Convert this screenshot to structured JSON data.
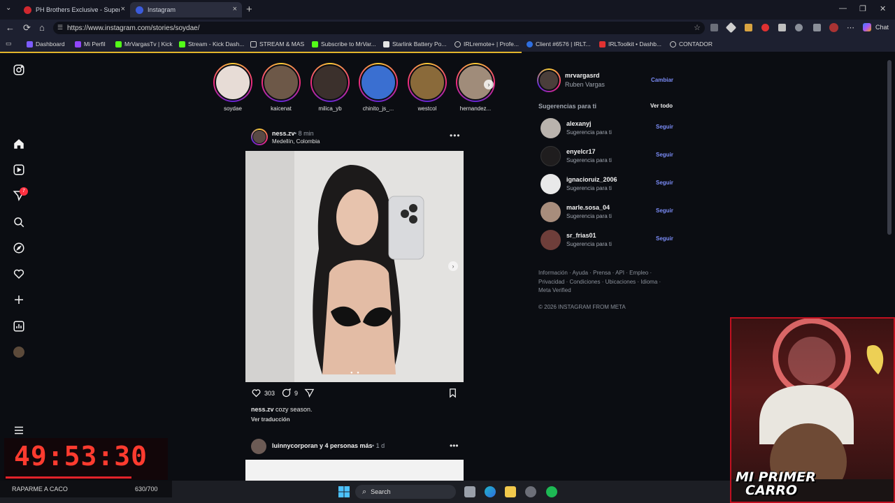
{
  "browser": {
    "tabs": [
      {
        "label": "PH Brothers Exclusive - SuperCarr",
        "active": false
      },
      {
        "label": "Instagram",
        "active": true
      }
    ],
    "url": "https://www.instagram.com/stories/soydae/",
    "chat_label": "Chat",
    "bookmarks": [
      "Dashboard",
      "Mi Perfil",
      "MrVargasTv | Kick",
      "Stream - Kick Dash...",
      "STREAM & MAS",
      "Subscribe to MrVar...",
      "Starlink Battery Po...",
      "IRLremote+ | Profe...",
      "Client #6576 | IRLT...",
      "IRLToolkit • Dashb...",
      "CONTADOR"
    ]
  },
  "sidebar": {
    "icons": [
      "instagram-icon",
      "home-icon",
      "reels-icon",
      "messages-icon",
      "search-icon",
      "explore-icon",
      "heart-icon",
      "create-icon",
      "dashboard-icon",
      "profile-icon",
      "menu-icon"
    ],
    "messages_badge": "7"
  },
  "stories": [
    "soydae",
    "kaicenat",
    "milica_yb",
    "chinito_js_...",
    "westcol",
    "hernandez..."
  ],
  "post": {
    "username": "ness.zv",
    "time": "• 8 min",
    "location": "Medellín, Colombia",
    "likes": "303",
    "comments": "9",
    "caption_user": "ness.zv",
    "caption_text": " cozy season.",
    "translate": "Ver traducción"
  },
  "post2": {
    "user_bold": "luinnycorporan",
    "user_rest": " y 4 personas más",
    "time": "• 1 d"
  },
  "account": {
    "username": "mrvargasrd",
    "name": "Ruben Vargas",
    "switch": "Cambiar"
  },
  "suggestions": {
    "title": "Sugerencias para ti",
    "see_all": "Ver todo",
    "items": [
      {
        "user": "alexanyj",
        "sub": "Sugerencia para ti",
        "follow": "Seguir"
      },
      {
        "user": "enyelcr17",
        "sub": "Sugerencia para ti",
        "follow": "Seguir"
      },
      {
        "user": "ignacioruiz_2006",
        "sub": "Sugerencia para ti",
        "follow": "Seguir"
      },
      {
        "user": "marle.sosa_04",
        "sub": "Sugerencia para ti",
        "follow": "Seguir"
      },
      {
        "user": "sr_frias01",
        "sub": "Sugerencia para ti",
        "follow": "Seguir"
      }
    ]
  },
  "footer": {
    "links": "Información · Ayuda · Prensa · API · Empleo · Privacidad · Condiciones · Ubicaciones · Idioma · Meta Verified",
    "copyright": "© 2026 INSTAGRAM FROM META"
  },
  "overlay": {
    "timer": "49:53:30",
    "goal_label": "RAPARME A CACO",
    "goal_count": "630/700",
    "cam_caption_1": "MI PRIMER",
    "cam_caption_2": "CARRO"
  },
  "taskbar": {
    "search": "Search"
  },
  "colors": {
    "accent_link": "#7b8cf7",
    "timer_red": "#ff3b2f",
    "badge_red": "#ff3040"
  }
}
